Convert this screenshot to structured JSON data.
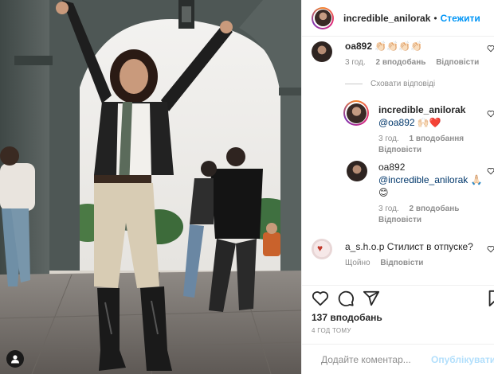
{
  "post": {
    "image_alt": "Woman in leather jacket and cowboy boots raising arms under stone archway",
    "tag_icon": "user-tag-icon"
  },
  "header": {
    "username": "incredible_anilorak",
    "separator": "•",
    "follow_label": "Стежити"
  },
  "comments": [
    {
      "username": "oa892",
      "text": "👏🏻👏🏻👏🏻👏🏻",
      "time": "3 год.",
      "likes": "2 вподобань",
      "reply_label": "Відповісти"
    }
  ],
  "hide_replies_label": "Сховати відповіді",
  "replies": [
    {
      "username": "incredible_anilorak",
      "mention": "@oa892",
      "text": "🙌🏻❤️",
      "time": "3 год.",
      "likes": "1 вподобання",
      "reply_label": "Відповісти"
    },
    {
      "username": "oa892",
      "mention": "@incredible_anilorak",
      "text": "🙏🏻 😊",
      "time": "3 год.",
      "likes": "2 вподобань",
      "reply_label": "Відповісти"
    }
  ],
  "comment_shop": {
    "username": "a_s.h.o.p",
    "text": "Стилист в отпуске?",
    "time": "Щойно",
    "reply_label": "Відповісти"
  },
  "actions": {
    "likes_count": "137 вподобань",
    "timestamp": "4 ГОД ТОМУ",
    "icons": [
      "heart-icon",
      "comment-icon",
      "share-icon",
      "bookmark-icon"
    ]
  },
  "add_comment": {
    "placeholder": "Додайте коментар...",
    "post_label": "Опублікувати",
    "emoji_icon": "emoji-icon"
  },
  "colors": {
    "accent": "#0095f6",
    "post_disabled": "#b2dffc",
    "muted": "#8e8e8e",
    "text": "#262626"
  }
}
